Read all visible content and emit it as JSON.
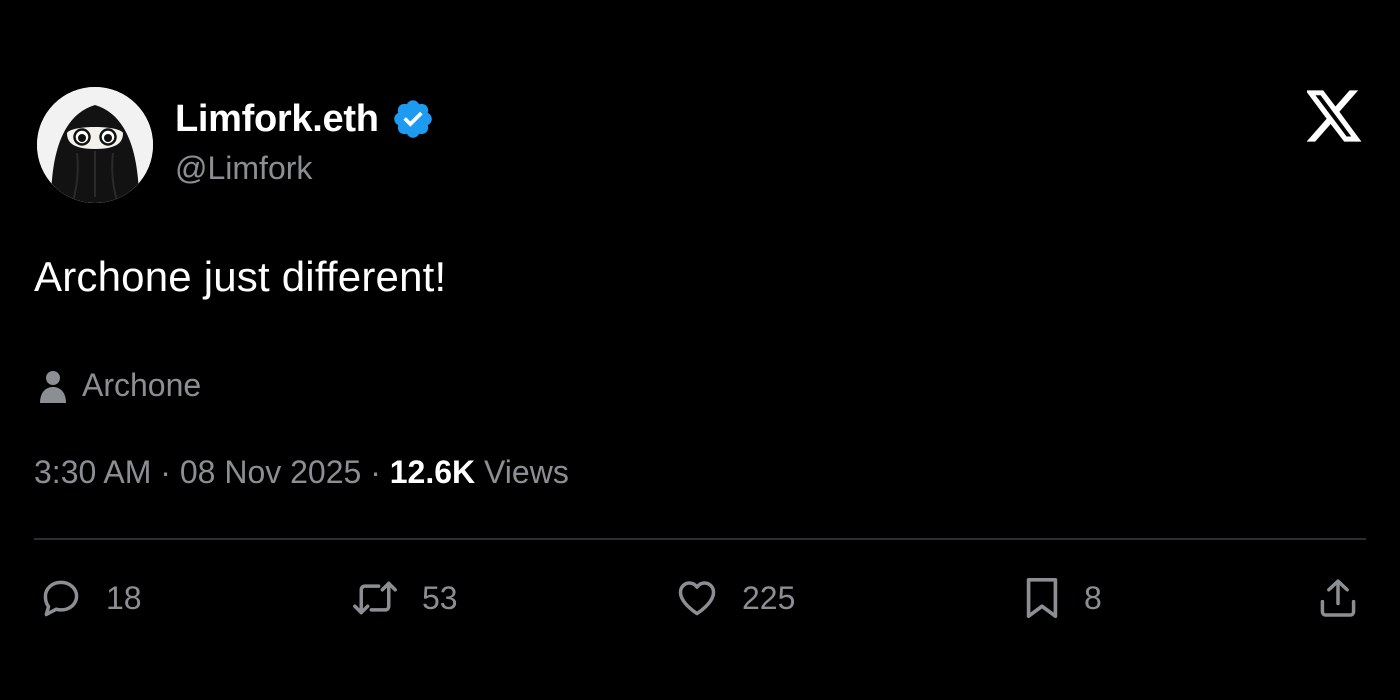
{
  "author": {
    "display_name": "Limfork.eth",
    "handle": "@Limfork",
    "verified": true,
    "avatar_icon": "hooded-ninja-avatar"
  },
  "platform_icon": "x-logo-icon",
  "tweet": {
    "text": "Archone just different!"
  },
  "community": {
    "icon": "person-icon",
    "label": "Archone"
  },
  "meta": {
    "time": "3:30 AM",
    "separator": "·",
    "date": "08 Nov 2025",
    "views_count": "12.6K",
    "views_label": "Views"
  },
  "actions": {
    "replies": {
      "icon": "reply-icon",
      "count": "18"
    },
    "reposts": {
      "icon": "repost-icon",
      "count": "53"
    },
    "likes": {
      "icon": "heart-icon",
      "count": "225"
    },
    "bookmarks": {
      "icon": "bookmark-icon",
      "count": "8"
    },
    "share": {
      "icon": "share-icon"
    }
  },
  "colors": {
    "background": "#000000",
    "primary_text": "#ffffff",
    "secondary_text": "#8b8f94",
    "verified_blue": "#1d9bf0",
    "divider": "#2a2d31"
  }
}
